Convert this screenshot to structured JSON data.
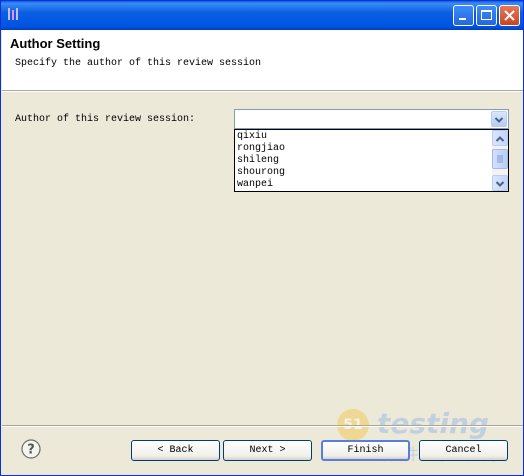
{
  "header": {
    "title": "Author Setting",
    "subtitle": "Specify the author of this review session"
  },
  "form": {
    "author_label": "Author of this review session:",
    "author_value": "",
    "options": [
      "qixiu",
      "rongjiao",
      "shileng",
      "shourong",
      "wanpei"
    ]
  },
  "buttons": {
    "back": "< Back",
    "next": "Next >",
    "finish": "Finish",
    "cancel": "Cancel"
  },
  "watermark": {
    "badge": "51",
    "text": "testing",
    "sub": "软件测试网"
  },
  "icons": {
    "window": "app-window-icon",
    "minimize": "minimize-icon",
    "maximize": "maximize-icon",
    "close": "close-icon",
    "dropdown": "chevron-down-icon",
    "help": "help-icon"
  },
  "colors": {
    "titlebar": "#0054e3",
    "dialog_bg": "#ece9d8",
    "header_bg": "#ffffff",
    "button_border": "#003c74"
  }
}
